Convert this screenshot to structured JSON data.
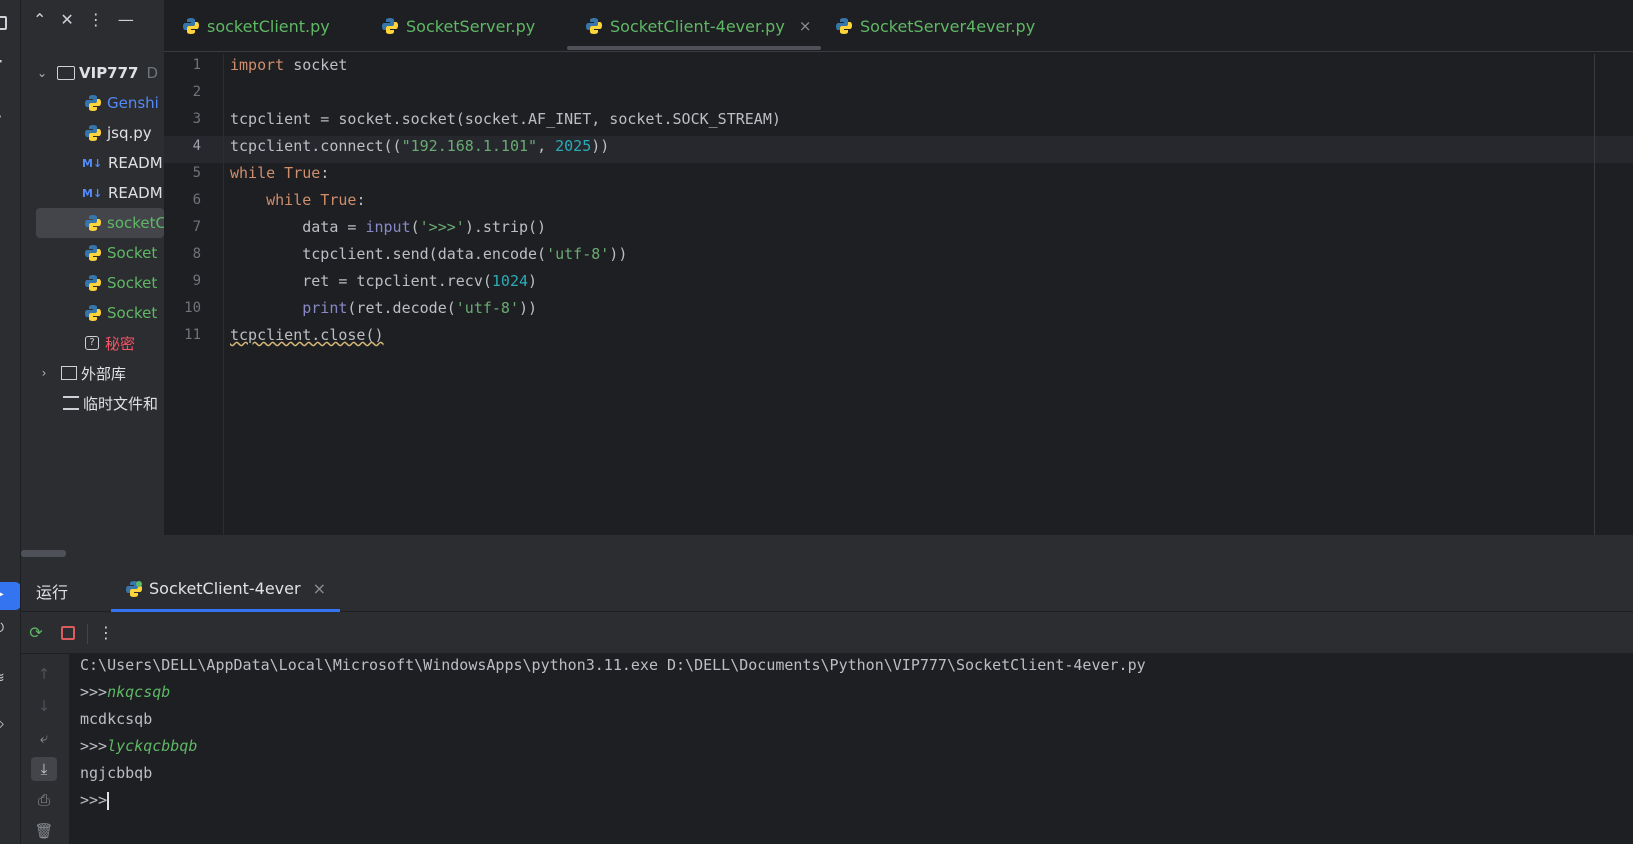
{
  "project_panel": {
    "root_name": "VIP777",
    "root_suffix": "D",
    "items": [
      {
        "label": "Genshi",
        "type": "python",
        "color": "#548af7"
      },
      {
        "label": "jsq.py",
        "type": "python",
        "color": "#dfe1e5"
      },
      {
        "label": "READM",
        "type": "markdown",
        "color": "#dfe1e5"
      },
      {
        "label": "READM",
        "type": "markdown",
        "color": "#dfe1e5"
      },
      {
        "label": "socketC",
        "type": "python",
        "color": "#5fb865",
        "selected": true
      },
      {
        "label": "Socket",
        "type": "python",
        "color": "#5fb865"
      },
      {
        "label": "Socket",
        "type": "python",
        "color": "#5fb865"
      },
      {
        "label": "Socket",
        "type": "python",
        "color": "#5fb865"
      },
      {
        "label": "秘密",
        "type": "unknown",
        "color": "#f75464"
      }
    ],
    "external_libs": "外部库",
    "scratches": "临时文件和"
  },
  "editor": {
    "tabs": [
      {
        "label": "socketClient.py"
      },
      {
        "label": "SocketServer.py"
      },
      {
        "label": "SocketClient-4ever.py",
        "active": true
      },
      {
        "label": "SocketServer4ever.py"
      }
    ],
    "tab_close_glyph": "×",
    "line_numbers": [
      "1",
      "2",
      "3",
      "4",
      "5",
      "6",
      "7",
      "8",
      "9",
      "10",
      "11"
    ],
    "current_line": "4",
    "code": {
      "l1_kw": "import",
      "l1_rest": " socket",
      "l3": "tcpclient = socket.socket(socket.AF_INET, socket.SOCK_STREAM)",
      "l4_a": "tcpclient.connect((",
      "l4_str": "\"192.168.1.101\"",
      "l4_b": ", ",
      "l4_num": "2025",
      "l4_c": "))",
      "l5_kw": "while",
      "l5_true": " True",
      "l5_colon": ":",
      "l6_indent": "    ",
      "l6_kw": "while",
      "l6_true": " True",
      "l6_colon": ":",
      "l7_a": "        data = ",
      "l7_fn": "input",
      "l7_b": "(",
      "l7_str": "'>>>'",
      "l7_c": ").strip()",
      "l8_a": "        tcpclient.send(data.encode(",
      "l8_str": "'utf-8'",
      "l8_c": "))",
      "l9_a": "        ret = tcpclient.recv(",
      "l9_num": "1024",
      "l9_c": ")",
      "l10_a": "        ",
      "l10_fn": "print",
      "l10_b": "(ret.decode(",
      "l10_str": "'utf-8'",
      "l10_c": "))",
      "l11": "tcpclient.close()"
    }
  },
  "run_window": {
    "title": "运行",
    "tab_label": "SocketClient-4ever",
    "tab_close_glyph": "×",
    "console": {
      "cmd": "C:\\Users\\DELL\\AppData\\Local\\Microsoft\\WindowsApps\\python3.11.exe D:\\DELL\\Documents\\Python\\VIP777\\SocketClient-4ever.py",
      "prompt": ">>>",
      "input1": "nkqcsqb",
      "output1": "mcdkcsqb",
      "input2": "lyckqcbbqb",
      "output2": "ngjcbbqb"
    }
  },
  "colors": {
    "accent": "#3574f0",
    "keyword": "#cf8e6d",
    "string": "#6aab73",
    "number": "#2aacb8",
    "builtin": "#8888c6",
    "modified_file": "#5fb865",
    "stop": "#db5c5c"
  }
}
